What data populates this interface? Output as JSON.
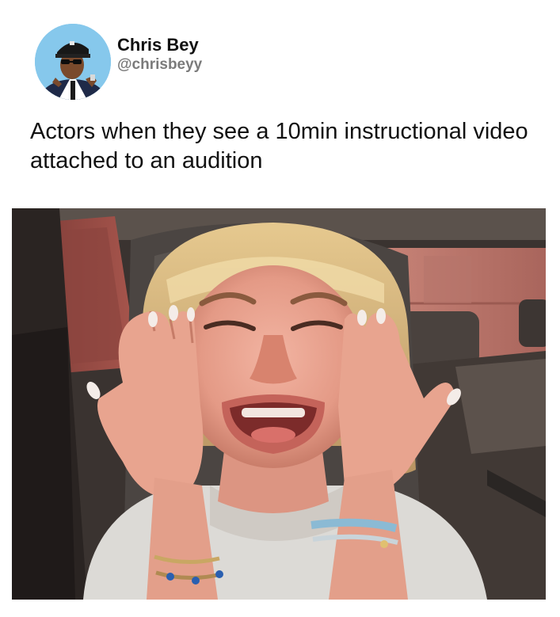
{
  "post": {
    "author": {
      "display_name": "Chris Bey",
      "handle": "@chrisbeyy",
      "avatar_icon": "profile-photo"
    },
    "caption": "Actors when they see a 10min instructional video attached to an audition",
    "photo": {
      "subject": "crying-woman-in-car-photo"
    }
  },
  "colors": {
    "background": "#ffffff",
    "text": "#111111",
    "handle": "#7b7b7b"
  }
}
